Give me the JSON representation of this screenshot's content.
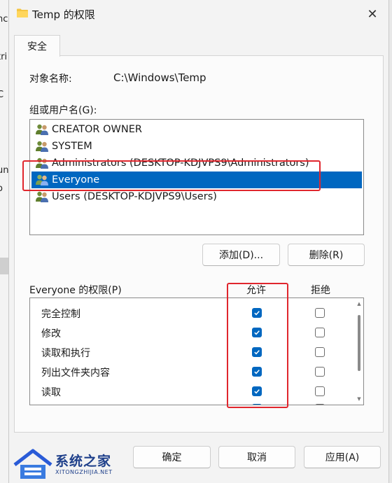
{
  "background": {
    "fragments": [
      "nc",
      "tri",
      "C",
      "un",
      "o"
    ]
  },
  "window": {
    "title": "Temp 的权限",
    "close_glyph": "✕"
  },
  "tab": {
    "label": "安全"
  },
  "object_name": {
    "label": "对象名称:",
    "value": "C:\\Windows\\Temp"
  },
  "groups": {
    "label": "组或用户名(G):",
    "items": [
      {
        "name": "CREATOR OWNER",
        "selected": false
      },
      {
        "name": "SYSTEM",
        "selected": false
      },
      {
        "name": "Administrators (DESKTOP-KDJVPS9\\Administrators)",
        "selected": false
      },
      {
        "name": "Everyone",
        "selected": true
      },
      {
        "name": "Users (DESKTOP-KDJVPS9\\Users)",
        "selected": false
      }
    ]
  },
  "buttons": {
    "add": "添加(D)...",
    "remove": "删除(R)",
    "ok": "确定",
    "cancel": "取消",
    "apply": "应用(A)"
  },
  "permissions": {
    "label": "Everyone 的权限(P)",
    "allow_header": "允许",
    "deny_header": "拒绝",
    "rows": [
      {
        "name": "完全控制",
        "allow": true,
        "deny": false
      },
      {
        "name": "修改",
        "allow": true,
        "deny": false
      },
      {
        "name": "读取和执行",
        "allow": true,
        "deny": false
      },
      {
        "name": "列出文件夹内容",
        "allow": true,
        "deny": false
      },
      {
        "name": "读取",
        "allow": true,
        "deny": false
      },
      {
        "name": "",
        "allow": true,
        "deny": false
      }
    ]
  },
  "watermark": {
    "brand": "系统之家",
    "url": "XITONGZHIJIA.NET"
  },
  "colors": {
    "accent": "#0067c0",
    "highlight": "#e0262d"
  }
}
